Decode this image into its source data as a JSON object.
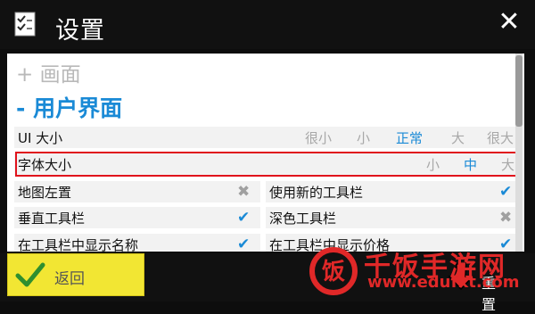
{
  "window": {
    "title": "设置"
  },
  "sections": {
    "collapsed": "+ 画面",
    "expanded": "- 用户界面"
  },
  "ui_size": {
    "label": "UI 大小",
    "options": [
      "很小",
      "小",
      "正常",
      "大",
      "很大"
    ],
    "selected": "正常"
  },
  "font_size": {
    "label": "字体大小",
    "options": [
      "小",
      "中",
      "大"
    ],
    "selected": "中"
  },
  "toggles": [
    {
      "label": "地图左置",
      "state": "off"
    },
    {
      "label": "使用新的工具栏",
      "state": "on"
    },
    {
      "label": "垂直工具栏",
      "state": "on"
    },
    {
      "label": "深色工具栏",
      "state": "off"
    },
    {
      "label": "在工具栏中显示名称",
      "state": "on"
    },
    {
      "label": "在工具栏中显示价格",
      "state": "on"
    }
  ],
  "footer": {
    "back_label": "返回",
    "reset_label": "重置"
  },
  "watermark": {
    "text": "千饭手游网",
    "url": "www.edufkt.com"
  },
  "colors": {
    "accent": "#1a8ad6",
    "highlight": "#e0121c",
    "back_button": "#f2e633"
  }
}
